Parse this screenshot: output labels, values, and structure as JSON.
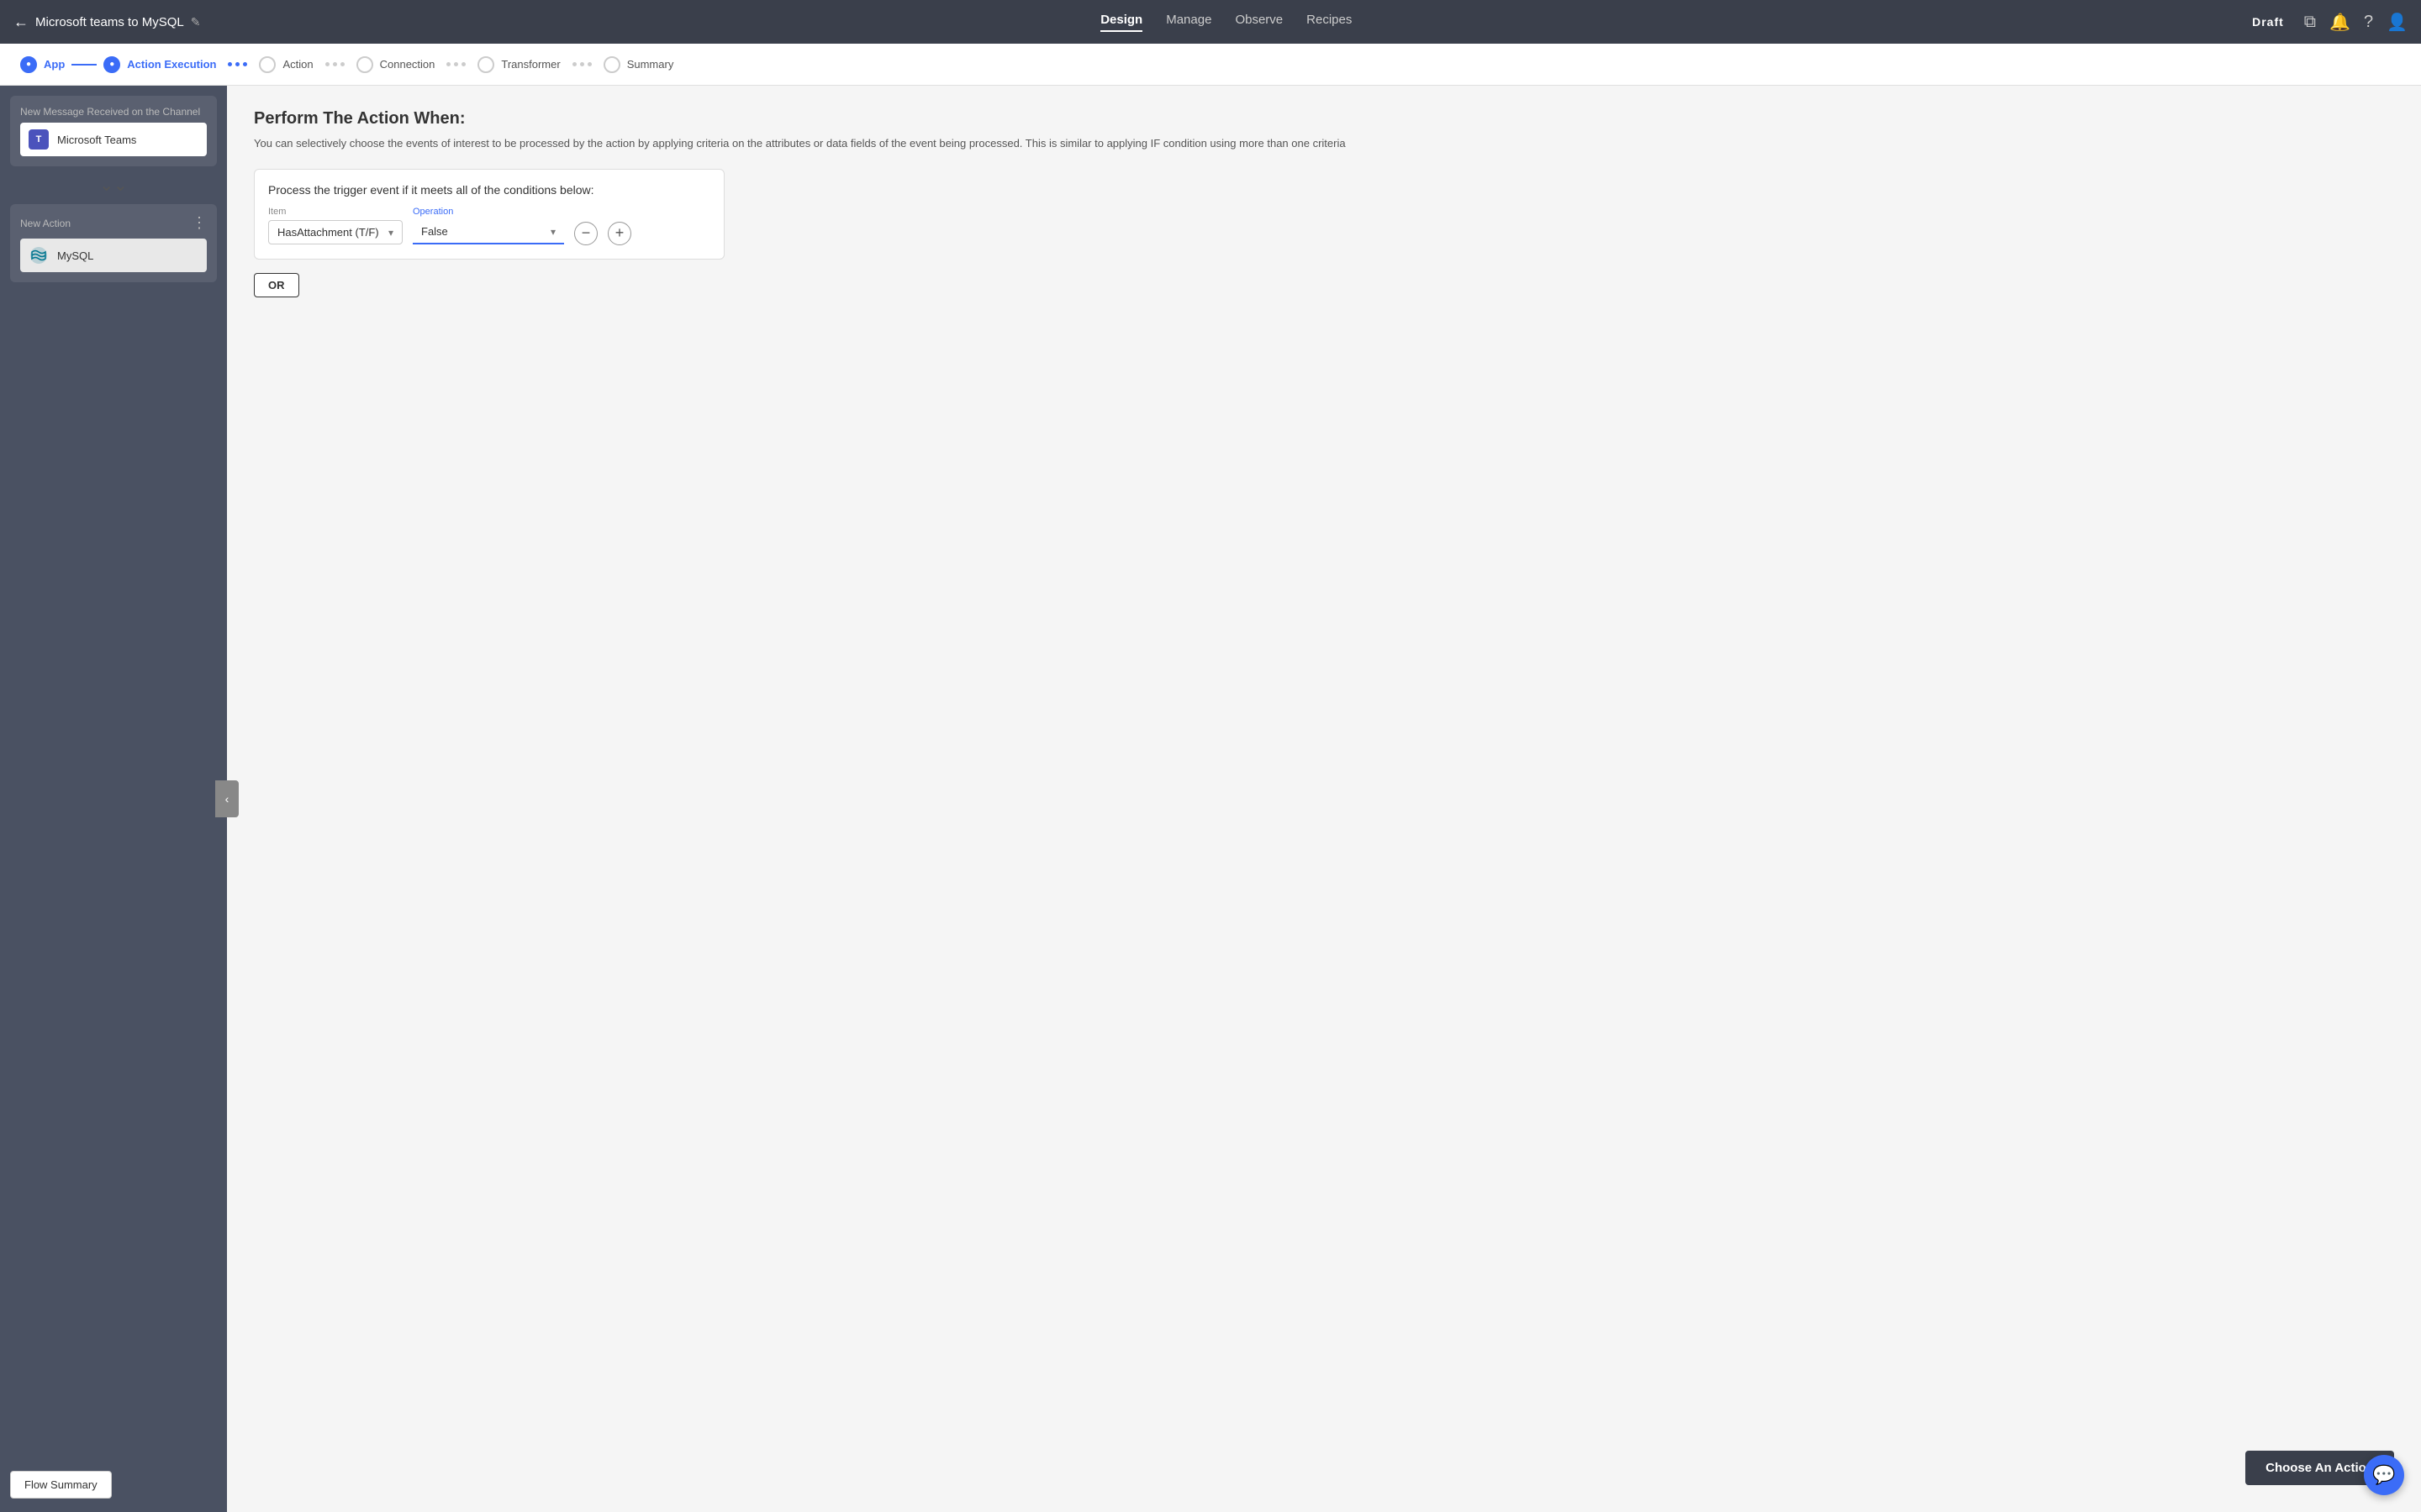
{
  "topNav": {
    "backArrow": "←",
    "flowTitle": "Microsoft teams to MySQL",
    "editIcon": "✎",
    "navItems": [
      "Design",
      "Manage",
      "Observe",
      "Recipes"
    ],
    "activeNav": "Design",
    "draftLabel": "Draft",
    "navIcons": [
      "⧉",
      "🔔",
      "?",
      "👤"
    ]
  },
  "stepper": {
    "steps": [
      {
        "id": "app",
        "label": "App",
        "state": "filled"
      },
      {
        "id": "action-execution",
        "label": "Action Execution",
        "state": "active"
      },
      {
        "id": "action",
        "label": "Action",
        "state": "empty"
      },
      {
        "id": "connection",
        "label": "Connection",
        "state": "empty"
      },
      {
        "id": "transformer",
        "label": "Transformer",
        "state": "empty"
      },
      {
        "id": "summary",
        "label": "Summary",
        "state": "empty"
      }
    ]
  },
  "sidebar": {
    "triggerLabel": "New Message Received on the Channel",
    "triggerService": "Microsoft Teams",
    "chevron": "⌄⌄",
    "actionLabel": "New Action",
    "actionService": "MySQL",
    "menuIcon": "⋮",
    "collapseIcon": "‹",
    "flowSummaryLabel": "Flow Summary"
  },
  "mainContent": {
    "sectionTitle": "Perform The Action When:",
    "sectionDesc": "You can selectively choose the events of interest to be processed by the action by applying criteria on the attributes or data fields of the event being processed. This is similar to applying IF condition using more than one criteria",
    "conditionLabel": "Process the trigger event if it meets all of the conditions below:",
    "itemColLabel": "Item",
    "operationColLabel": "Operation",
    "itemValue": "HasAttachment (T/F)",
    "operationValue": "False",
    "orButton": "OR",
    "chooseActionBtn": "Choose An Action"
  }
}
